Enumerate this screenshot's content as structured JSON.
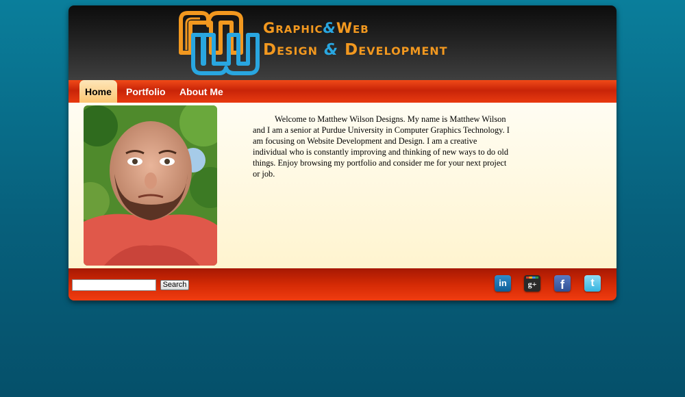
{
  "header": {
    "logo_monogram": "MW",
    "tagline_line1_a": "Graphic",
    "tagline_amp1": "&",
    "tagline_line1_b": "Web",
    "tagline_line2_a": "Design",
    "tagline_amp2": "&",
    "tagline_line2_b": "Development"
  },
  "nav": {
    "items": [
      {
        "label": "Home",
        "active": true
      },
      {
        "label": "Portfolio",
        "active": false
      },
      {
        "label": "About Me",
        "active": false
      }
    ]
  },
  "main": {
    "intro": "Welcome to Matthew Wilson Designs. My name is Matthew Wilson and I am a senior at Purdue University in Computer Graphics Technology. I am focusing on Website Development and Design. I am a creative individual who is constantly improving and thinking of new ways to do old things. Enjoy browsing my portfolio and consider me for your next project or job."
  },
  "footer": {
    "search_value": "",
    "search_button": "Search",
    "social": [
      {
        "name": "linkedin-icon",
        "glyph": "in"
      },
      {
        "name": "google-plus-icon",
        "glyph": "g+"
      },
      {
        "name": "facebook-icon",
        "glyph": "f"
      },
      {
        "name": "twitter-icon",
        "glyph": "t"
      }
    ]
  },
  "colors": {
    "page_bg": "#0a7e9b",
    "header_bg": "#222222",
    "accent_orange": "#f2981f",
    "accent_blue": "#29a6e0",
    "nav_red": "#d42a05",
    "active_tab": "#fcc673",
    "content_bg": "#fff4cf"
  }
}
